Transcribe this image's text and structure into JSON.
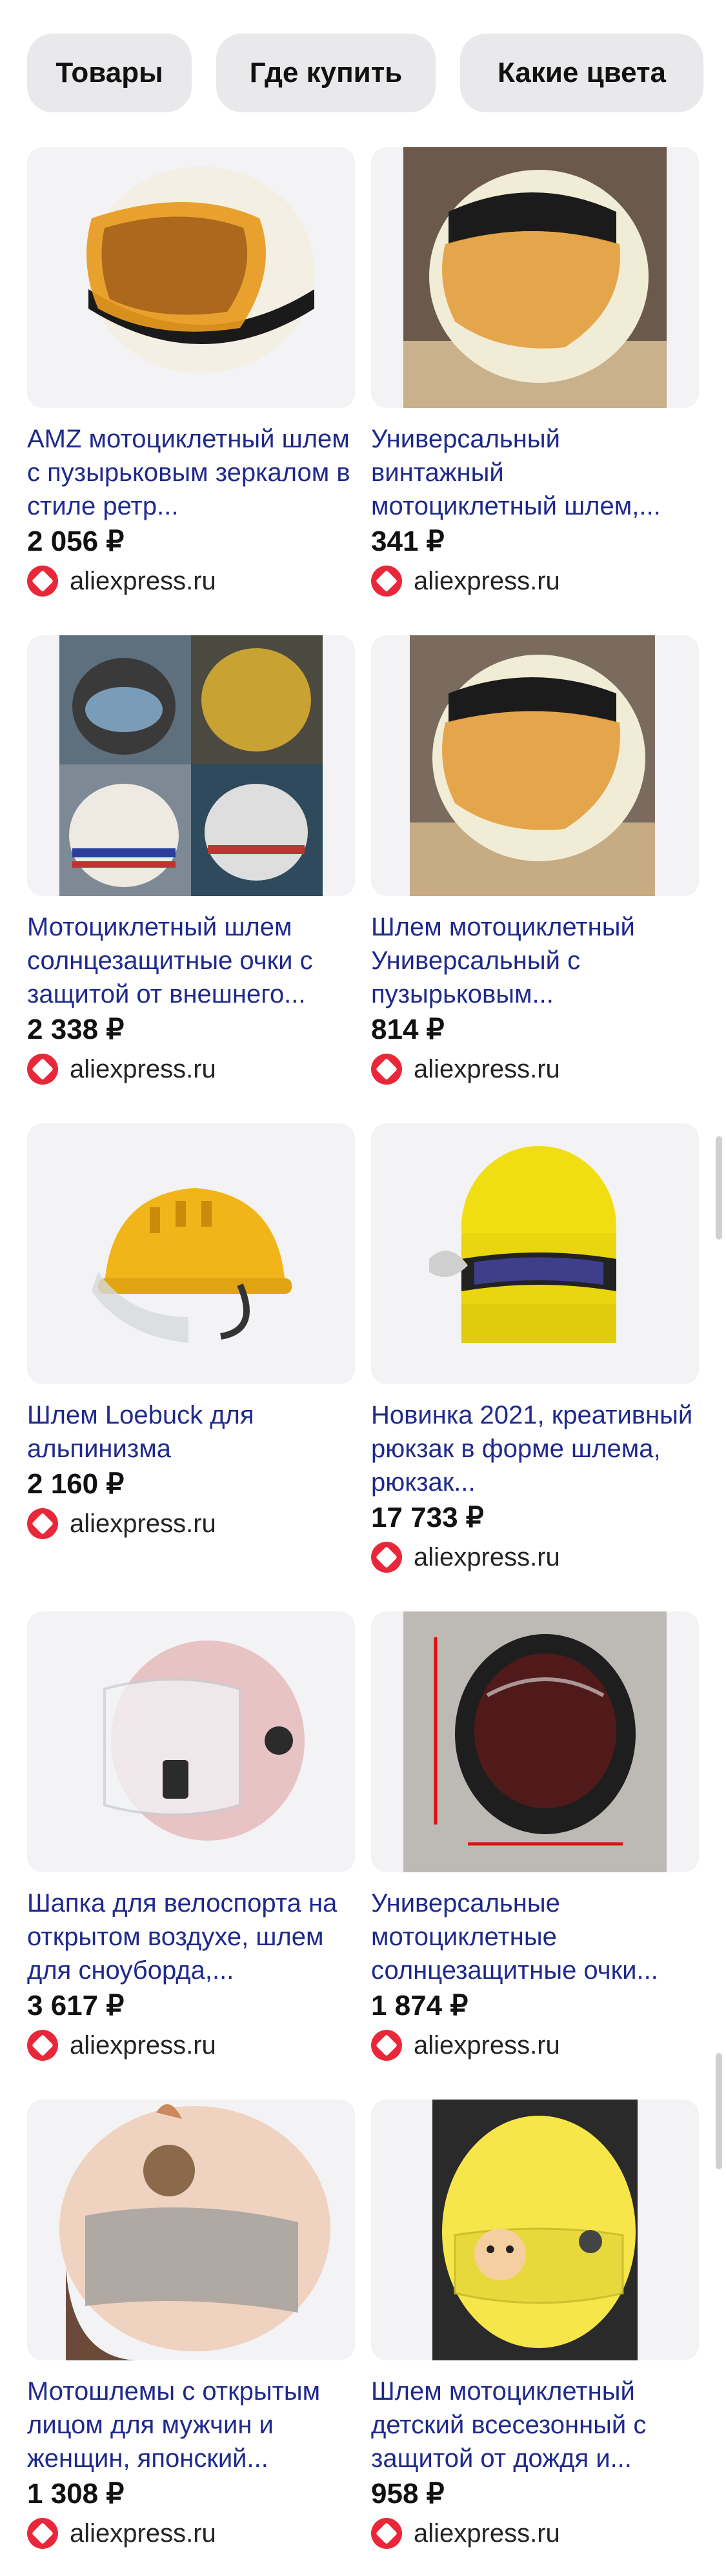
{
  "chips": [
    "Товары",
    "Где купить",
    "Какие цвета"
  ],
  "products": [
    {
      "title": "AMZ мотоциклетный шлем с пузырьковым зеркалом в стиле ретр...",
      "price": "2 056 ₽",
      "shop": "aliexpress.ru"
    },
    {
      "title": "Универсальный винтажный мотоциклетный шлем,...",
      "price": "341 ₽",
      "shop": "aliexpress.ru"
    },
    {
      "title": "Мотоциклетный шлем солнцезащитные очки с защитой от внешнего...",
      "price": "2 338 ₽",
      "shop": "aliexpress.ru"
    },
    {
      "title": "Шлем мотоциклетный Универсальный с пузырьковым...",
      "price": "814 ₽",
      "shop": "aliexpress.ru"
    },
    {
      "title": "Шлем Loebuck для альпинизма",
      "price": "2 160 ₽",
      "shop": "aliexpress.ru"
    },
    {
      "title": "Новинка 2021, креативный рюкзак в форме шлема, рюкзак...",
      "price": "17 733 ₽",
      "shop": "aliexpress.ru"
    },
    {
      "title": "Шапка для велоспорта на открытом воздухе, шлем для сноуборда,...",
      "price": "3 617 ₽",
      "shop": "aliexpress.ru"
    },
    {
      "title": "Универсальные мотоциклетные солнцезащитные очки...",
      "price": "1 874 ₽",
      "shop": "aliexpress.ru"
    },
    {
      "title": "Мотошлемы с открытым лицом для мужчин и женщин, японский...",
      "price": "1 308 ₽",
      "shop": "aliexpress.ru"
    },
    {
      "title": "Шлем мотоциклетный детский всесезонный с защитой от дождя и...",
      "price": "958 ₽",
      "shop": "aliexpress.ru"
    }
  ],
  "colors": {
    "title_link": "#1f2a8c",
    "shop_logo": "#e8283a",
    "chip_bg": "#e9e9ec"
  }
}
